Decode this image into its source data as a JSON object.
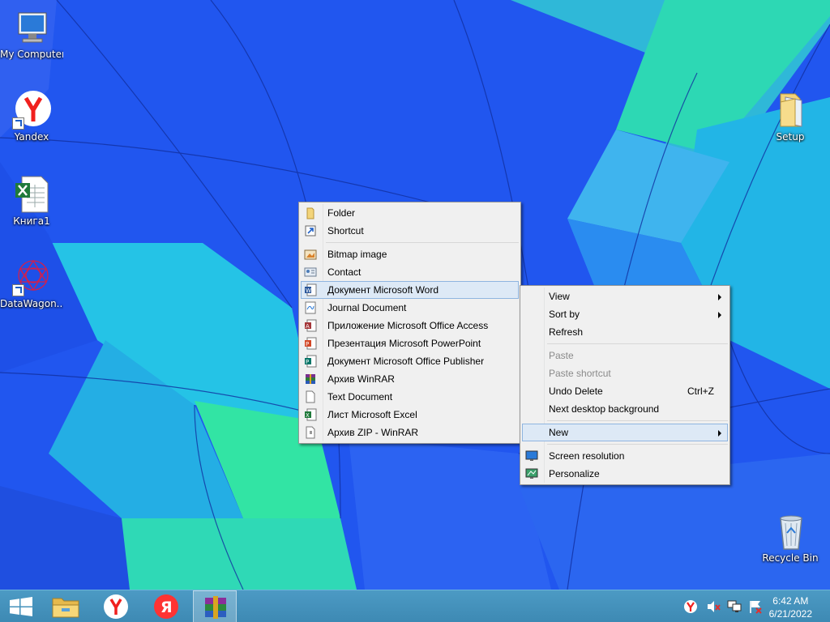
{
  "desktop": {
    "icons": [
      {
        "label": "My Computer",
        "icon": "computer-icon"
      },
      {
        "label": "Yandex",
        "icon": "yandex-browser-icon"
      },
      {
        "label": "Книга1",
        "icon": "excel-workbook-icon"
      },
      {
        "label": "DataWagon...",
        "icon": "datawagon-icon"
      },
      {
        "label": "Setup",
        "icon": "folder-icon"
      },
      {
        "label": "Recycle Bin",
        "icon": "recycle-bin-icon"
      }
    ]
  },
  "context_menu": {
    "items": [
      {
        "label": "View",
        "submenu": true
      },
      {
        "label": "Sort by",
        "submenu": true
      },
      {
        "label": "Refresh"
      },
      {
        "label": "Paste",
        "disabled": true
      },
      {
        "label": "Paste shortcut",
        "disabled": true
      },
      {
        "label": "Undo Delete",
        "shortcut": "Ctrl+Z"
      },
      {
        "label": "Next desktop background"
      },
      {
        "label": "New",
        "submenu": true,
        "highlighted": true
      },
      {
        "label": "Screen resolution",
        "icon": "monitor-icon"
      },
      {
        "label": "Personalize",
        "icon": "personalize-icon"
      }
    ]
  },
  "new_submenu": {
    "items": [
      {
        "label": "Folder",
        "icon": "folder-icon"
      },
      {
        "label": "Shortcut",
        "icon": "shortcut-icon"
      },
      {
        "label": "Bitmap image",
        "icon": "bitmap-icon"
      },
      {
        "label": "Contact",
        "icon": "contact-icon"
      },
      {
        "label": "Документ Microsoft Word",
        "icon": "word-document-icon",
        "highlighted": true
      },
      {
        "label": "Journal Document",
        "icon": "journal-icon"
      },
      {
        "label": "Приложение Microsoft Office Access",
        "icon": "access-icon"
      },
      {
        "label": "Презентация Microsoft PowerPoint",
        "icon": "powerpoint-icon"
      },
      {
        "label": "Документ Microsoft Office Publisher",
        "icon": "publisher-icon"
      },
      {
        "label": "Архив WinRAR",
        "icon": "winrar-icon"
      },
      {
        "label": "Text Document",
        "icon": "text-document-icon"
      },
      {
        "label": "Лист Microsoft Excel",
        "icon": "excel-icon"
      },
      {
        "label": "Архив ZIP - WinRAR",
        "icon": "zip-icon"
      }
    ]
  },
  "taskbar": {
    "buttons": [
      "start-icon",
      "file-explorer-icon",
      "yandex-browser-icon",
      "yandex-icon",
      "winrar-icon"
    ],
    "tray": [
      "yandex-tray-icon",
      "volume-muted-icon",
      "network-icon",
      "action-center-icon"
    ],
    "clock": {
      "time": "6:42 AM",
      "date": "6/21/2022"
    }
  },
  "colors": {
    "accent": "#3d89b3",
    "highlight": "#dde9f6"
  }
}
